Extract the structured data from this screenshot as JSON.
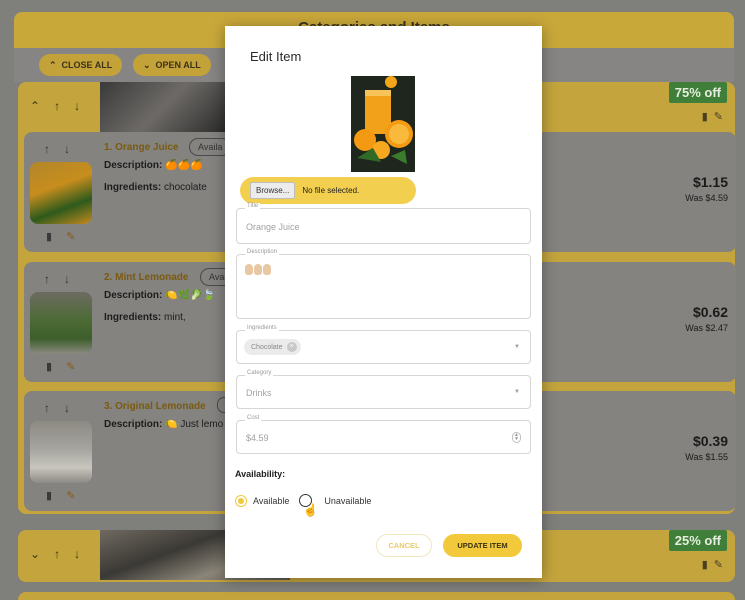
{
  "background": {
    "header_title": "Categories and Items",
    "toolbar": {
      "close_all": "CLOSE ALL",
      "open_all": "OPEN ALL"
    },
    "categories": [
      {
        "discount": "75% off"
      },
      {
        "discount": "25% off"
      }
    ],
    "items": [
      {
        "name": "1. Orange Juice",
        "availability": "Availa",
        "description_label": "Description:",
        "description": "🍊🍊🍊",
        "ingredients_label": "Ingredients:",
        "ingredients": "chocolate",
        "price": "$1.15",
        "was_price": "Was $4.59"
      },
      {
        "name": "2. Mint Lemonade",
        "availability": "Avail",
        "description_label": "Description:",
        "description": "🍋🌿🥬🍃",
        "ingredients_label": "Ingredients:",
        "ingredients": "mint,",
        "price": "$0.62",
        "was_price": "Was $2.47"
      },
      {
        "name": "3. Original Lemonade",
        "availability": "",
        "description_label": "Description:",
        "description": "🍋 Just lemo",
        "ingredients_label": "",
        "ingredients": "",
        "price": "$0.39",
        "was_price": "Was $1.55"
      }
    ]
  },
  "modal": {
    "title": "Edit Item",
    "file": {
      "browse_label": "Browse...",
      "status": "No file selected."
    },
    "title_field": {
      "label": "Title",
      "value": "Orange Juice"
    },
    "description_field": {
      "label": "Description"
    },
    "ingredients_field": {
      "label": "Ingredients",
      "chip": "Chocolate"
    },
    "category_field": {
      "label": "Category",
      "value": "Drinks"
    },
    "cost_field": {
      "label": "Cost",
      "value": "$4.59"
    },
    "availability": {
      "title": "Availability:",
      "options": [
        "Available",
        "Unavailable"
      ],
      "selected": "Available"
    },
    "buttons": {
      "cancel": "CANCEL",
      "update": "UPDATE ITEM"
    }
  },
  "colors": {
    "accent": "#f1c93a",
    "badge": "#3f7f3a"
  }
}
